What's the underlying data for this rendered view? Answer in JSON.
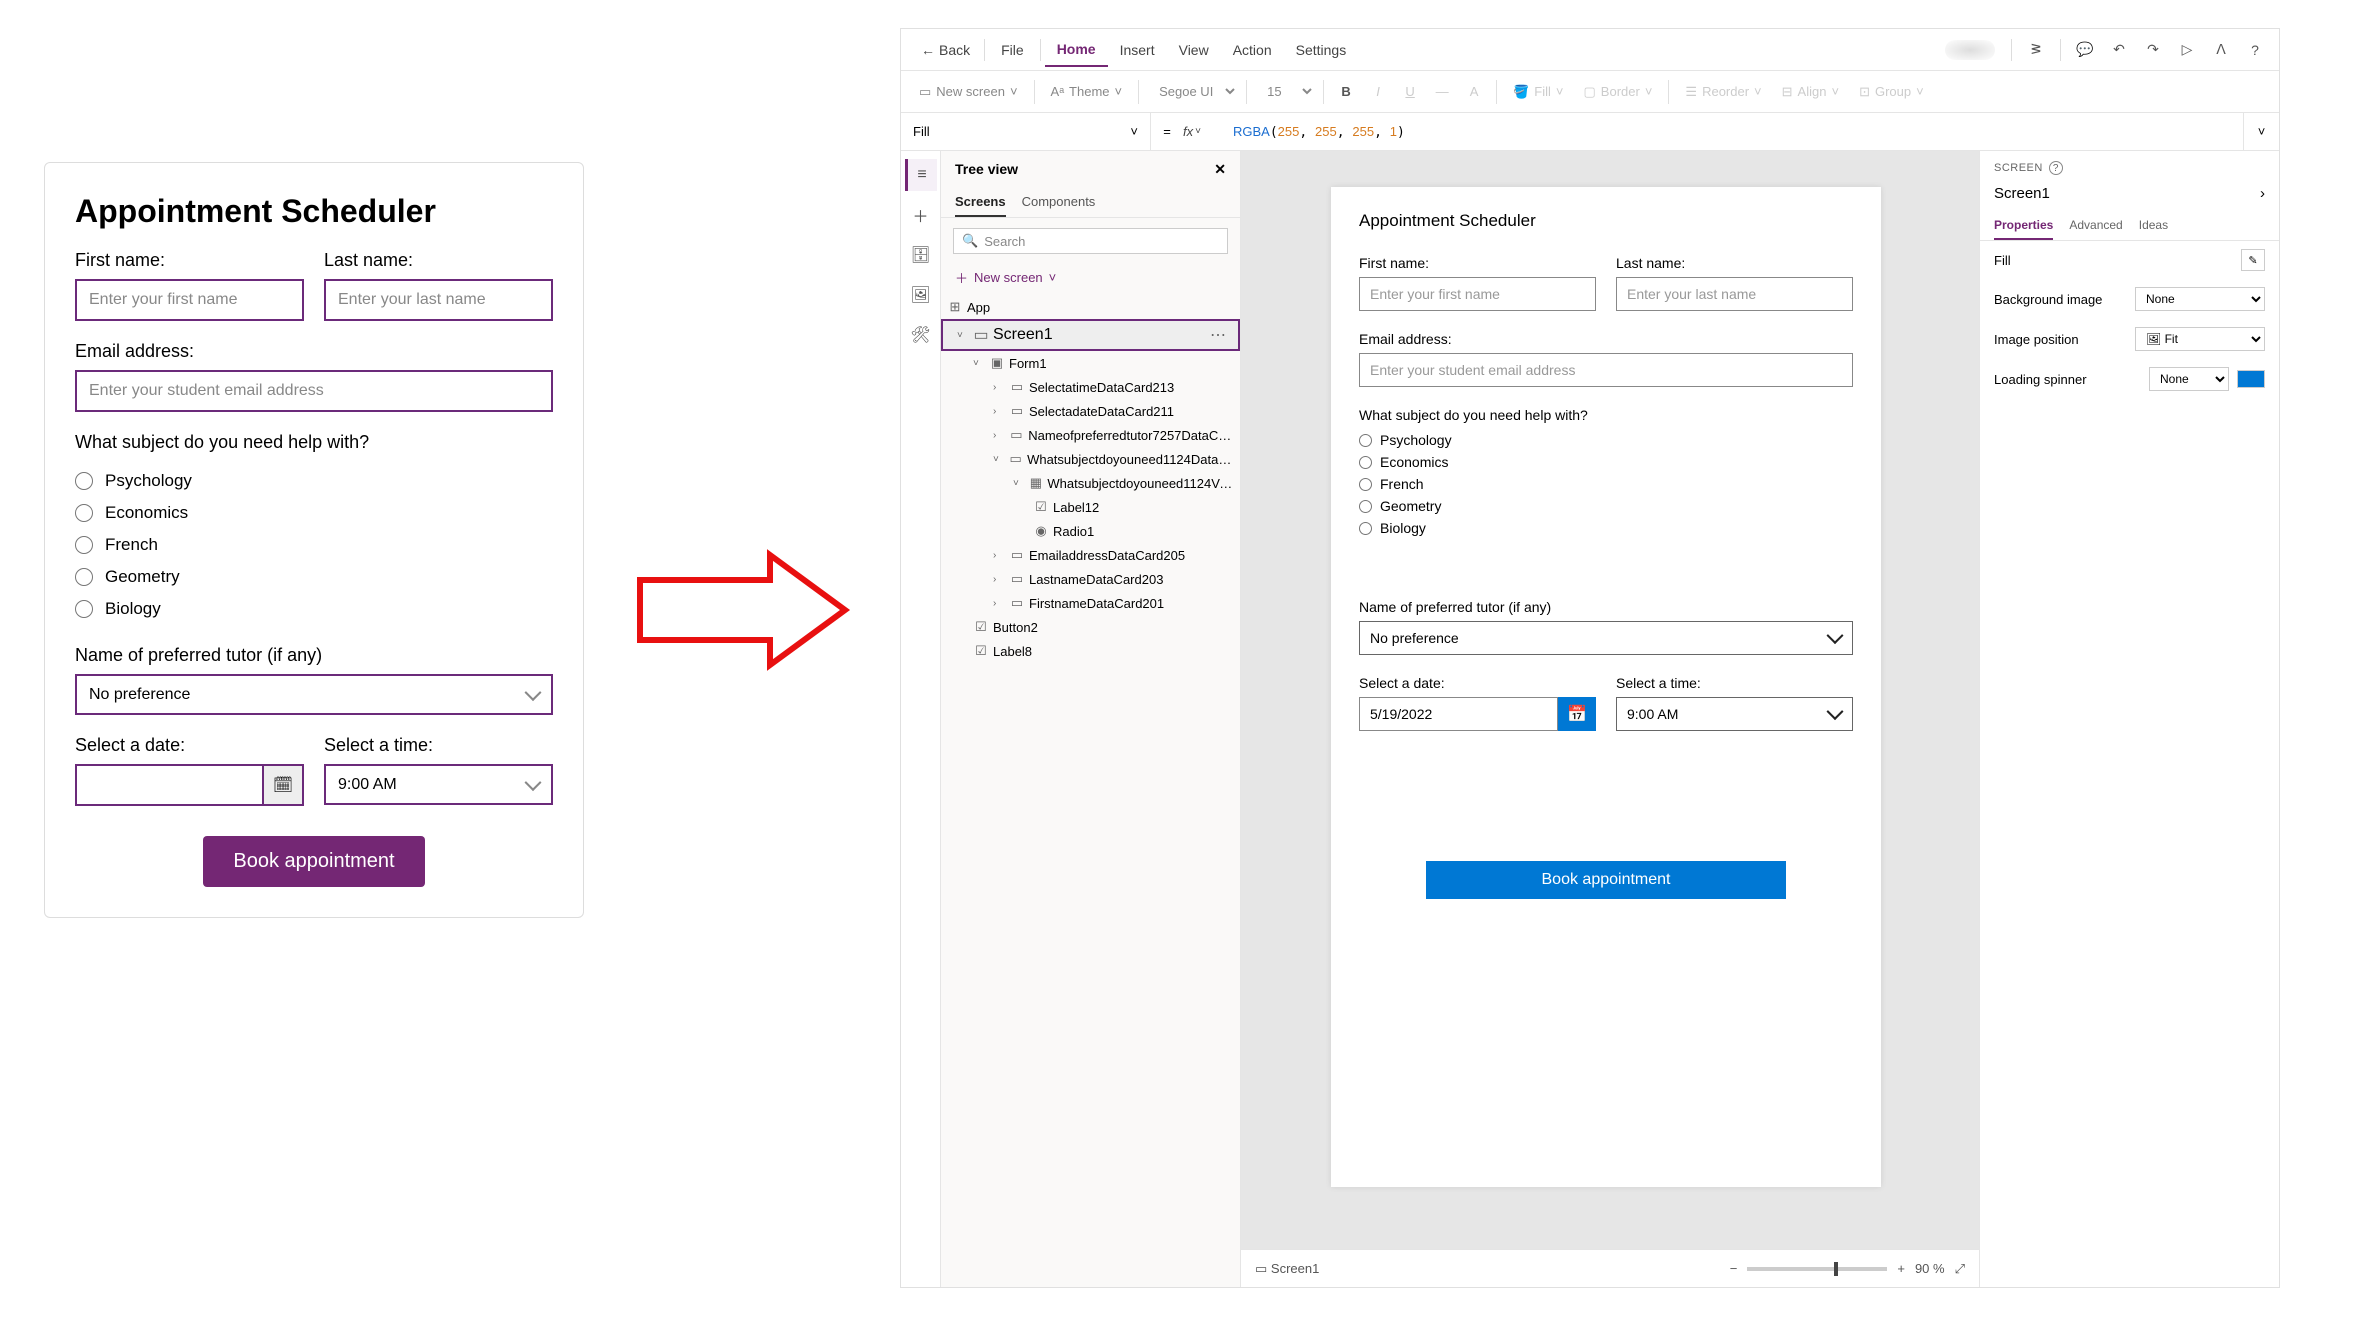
{
  "leftForm": {
    "title": "Appointment Scheduler",
    "firstNameLabel": "First name:",
    "firstNamePh": "Enter your first name",
    "lastNameLabel": "Last name:",
    "lastNamePh": "Enter your last name",
    "emailLabel": "Email address:",
    "emailPh": "Enter your student email address",
    "subjectQ": "What subject do you need help with?",
    "subjects": {
      "s0": "Psychology",
      "s1": "Economics",
      "s2": "French",
      "s3": "Geometry",
      "s4": "Biology"
    },
    "tutorLabel": "Name of preferred tutor (if any)",
    "tutorValue": "No preference",
    "dateLabel": "Select a date:",
    "timeLabel": "Select a time:",
    "timeValue": "9:00 AM",
    "bookBtn": "Book appointment"
  },
  "topbar": {
    "back": "Back",
    "file": "File",
    "home": "Home",
    "insert": "Insert",
    "view": "View",
    "action": "Action",
    "settings": "Settings"
  },
  "ribbon": {
    "newScreen": "New screen",
    "theme": "Theme",
    "font": "Segoe UI",
    "size": "15",
    "fill": "Fill",
    "border": "Border",
    "reorder": "Reorder",
    "align": "Align",
    "group": "Group"
  },
  "fbar": {
    "prop": "Fill",
    "formulaFn": "RGBA",
    "formulaArgs": {
      "a0": "255",
      "a1": "255",
      "a2": "255",
      "a3": "1"
    }
  },
  "tree": {
    "title": "Tree view",
    "tabScreens": "Screens",
    "tabComponents": "Components",
    "searchPh": "Search",
    "newScreen": "New screen",
    "app": "App",
    "screen1": "Screen1",
    "form1": "Form1",
    "n1": "SelectatimeDataCard213",
    "n2": "SelectadateDataCard211",
    "n3": "Nameofpreferredtutor7257DataCar...",
    "n4": "Whatsubjectdoyouneed1124DataCar...",
    "n5": "Whatsubjectdoyouneed1124Vert...",
    "n6": "Label12",
    "n7": "Radio1",
    "n8": "EmailaddressDataCard205",
    "n9": "LastnameDataCard203",
    "n10": "FirstnameDataCard201",
    "n11": "Button2",
    "n12": "Label8"
  },
  "canvas": {
    "title": "Appointment Scheduler",
    "firstNameLabel": "First name:",
    "firstNamePh": "Enter your first name",
    "lastNameLabel": "Last name:",
    "lastNamePh": "Enter your last name",
    "emailLabel": "Email address:",
    "emailPh": "Enter your student email address",
    "subjectQ": "What subject do you need help with?",
    "subjects": {
      "s0": "Psychology",
      "s1": "Economics",
      "s2": "French",
      "s3": "Geometry",
      "s4": "Biology"
    },
    "tutorLabel": "Name of preferred tutor (if any)",
    "tutorValue": "No preference",
    "dateLabel": "Select a date:",
    "dateValue": "5/19/2022",
    "timeLabel": "Select a time:",
    "timeValue": "9:00 AM",
    "bookBtn": "Book appointment"
  },
  "statusbar": {
    "screen": "Screen1",
    "zoom": "90 %"
  },
  "props": {
    "hdr": "SCREEN",
    "name": "Screen1",
    "tabProps": "Properties",
    "tabAdv": "Advanced",
    "tabIdeas": "Ideas",
    "fill": "Fill",
    "bgimg": "Background image",
    "bgimgVal": "None",
    "imgpos": "Image position",
    "imgposVal": "Fit",
    "spinner": "Loading spinner",
    "spinnerVal": "None"
  }
}
